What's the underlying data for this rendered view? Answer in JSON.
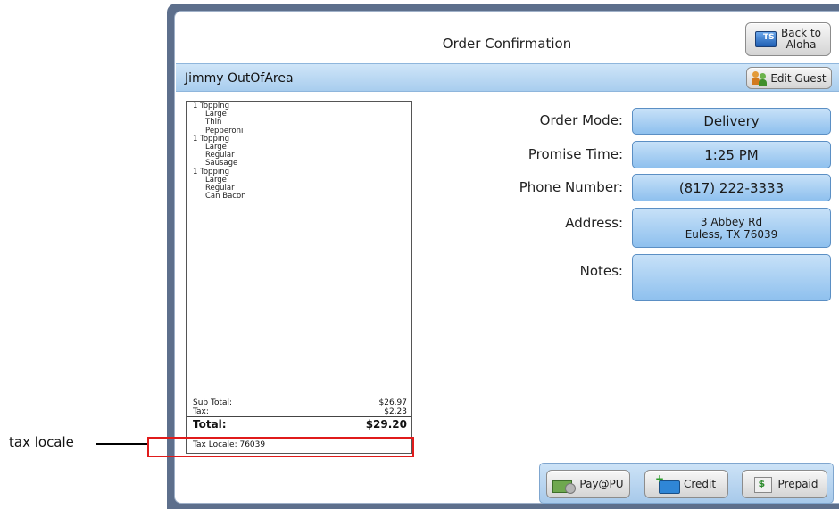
{
  "annotation": {
    "label": "tax locale"
  },
  "window": {
    "title": "Order Confirmation",
    "back_button": {
      "line1": "Back to",
      "line2": "Aloha",
      "icon": "ts-monitor-icon"
    }
  },
  "guest": {
    "name": "Jimmy OutOfArea",
    "edit_button": "Edit Guest",
    "edit_icon": "people-icon"
  },
  "receipt": {
    "items": [
      {
        "name": "1 Topping",
        "mods": [
          "Large",
          "Thin",
          "Pepperoni"
        ]
      },
      {
        "name": "1 Topping",
        "mods": [
          "Large",
          "Regular",
          "Sausage"
        ]
      },
      {
        "name": "1 Topping",
        "mods": [
          "Large",
          "Regular",
          "Can Bacon"
        ]
      }
    ],
    "subtotal_label": "Sub Total:",
    "subtotal": "$26.97",
    "tax_label": "Tax:",
    "tax": "$2.23",
    "total_label": "Total:",
    "total": "$29.20",
    "tax_locale": "Tax Locale: 76039"
  },
  "fields": {
    "order_mode": {
      "label": "Order Mode:",
      "value": "Delivery"
    },
    "promise_time": {
      "label": "Promise Time:",
      "value": "1:25 PM"
    },
    "phone": {
      "label": "Phone Number:",
      "value": "(817) 222-3333"
    },
    "address": {
      "label": "Address:",
      "line1": "3 Abbey Rd",
      "line2": "Euless, TX 76039"
    },
    "notes": {
      "label": "Notes:",
      "value": ""
    }
  },
  "payments": [
    {
      "label": "Pay@PU",
      "icon": "cash-icon"
    },
    {
      "label": "Credit",
      "icon": "credit-card-icon"
    },
    {
      "label": "Prepaid",
      "icon": "prepaid-icon"
    }
  ]
}
